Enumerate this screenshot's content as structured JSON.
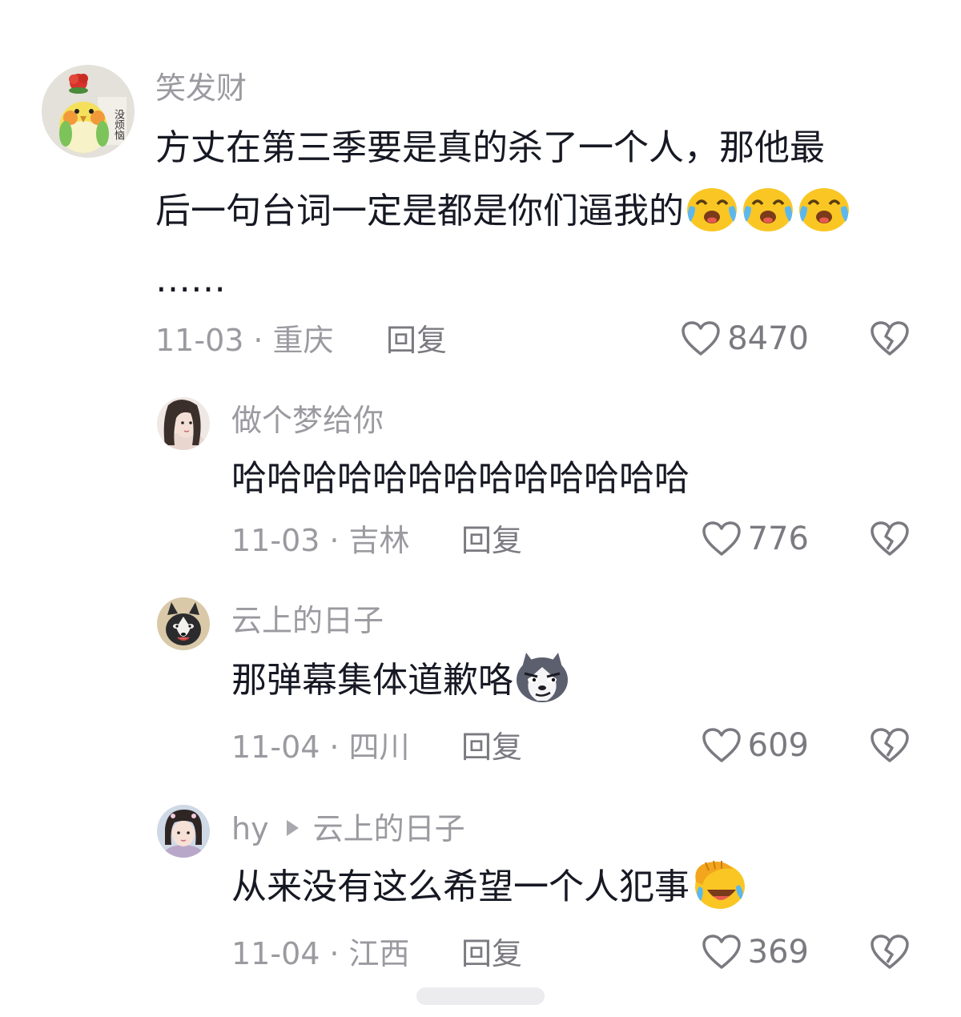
{
  "comments": [
    {
      "username": "笑发财",
      "text_line1": "方丈在第三季要是真的杀了一个人，那他最",
      "text_line2": "后一句台词一定是都是你们逼我的",
      "text_line3": "……",
      "emoji": "crying-laughing-emoji",
      "date": "11-03",
      "location": "重庆",
      "reply_label": "回复",
      "likes": "8470",
      "avatar_badge": "没烦恼"
    },
    {
      "username": "做个梦给你",
      "text": "哈哈哈哈哈哈哈哈哈哈哈哈哈",
      "date": "11-03",
      "location": "吉林",
      "reply_label": "回复",
      "likes": "776"
    },
    {
      "username": "云上的日子",
      "text": "那弹幕集体道歉咯",
      "emoji": "husky-smirk-emoji",
      "date": "11-04",
      "location": "四川",
      "reply_label": "回复",
      "likes": "609"
    },
    {
      "username": "hy",
      "reply_to": "云上的日子",
      "text": "从来没有这么希望一个人犯事",
      "emoji": "facepalm-laughing-emoji",
      "date": "11-04",
      "location": "江西",
      "reply_label": "回复",
      "likes": "369"
    }
  ],
  "colors": {
    "text": "#161823",
    "meta": "#9a9aa0",
    "icon": "#7a7a80",
    "emoji_yellow": "#f9c623"
  }
}
